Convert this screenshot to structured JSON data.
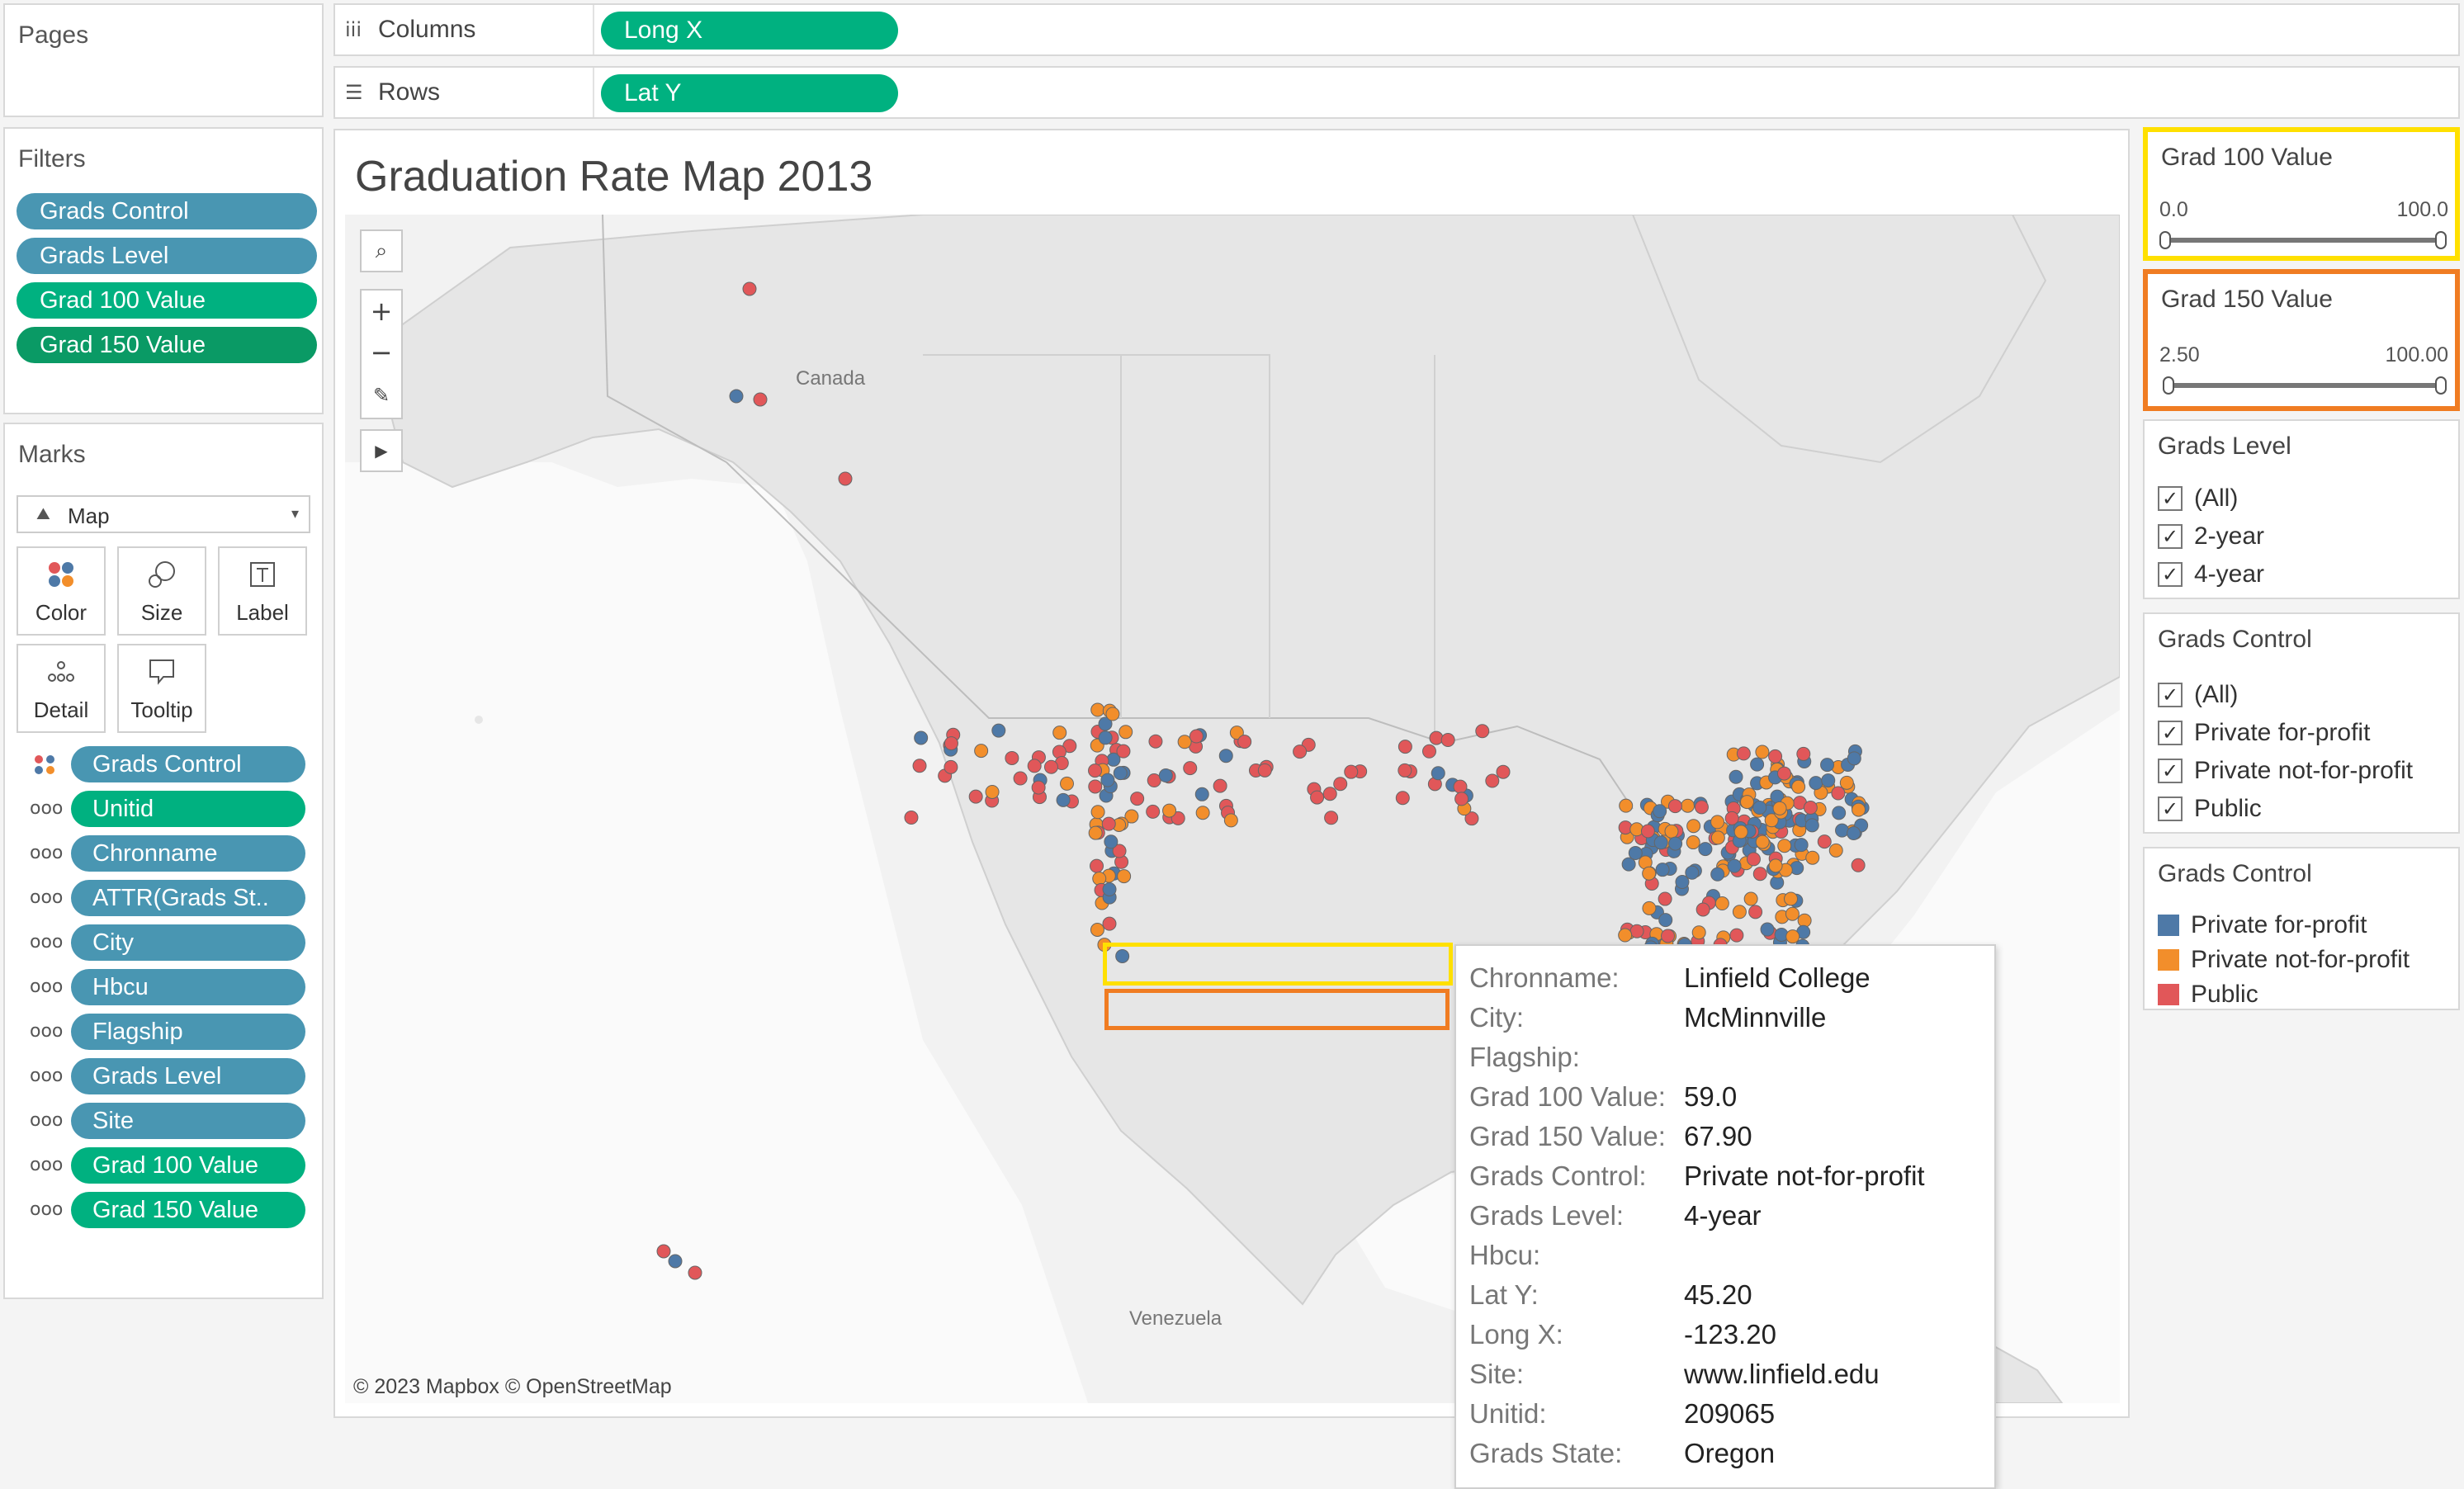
{
  "pages": {
    "title": "Pages"
  },
  "shelves": {
    "columns": {
      "label": "Columns",
      "pill": "Long X",
      "icon": "columns-icon"
    },
    "rows": {
      "label": "Rows",
      "pill": "Lat Y",
      "icon": "rows-icon"
    }
  },
  "filters": {
    "title": "Filters",
    "items": [
      "Grads Control",
      "Grads Level",
      "Grad 100 Value",
      "Grad 150 Value"
    ]
  },
  "marks": {
    "title": "Marks",
    "mark_type": "Map",
    "buttons": [
      "Color",
      "Size",
      "Label",
      "Detail",
      "Tooltip"
    ],
    "fields": [
      "Grads Control",
      "Unitid",
      "Chronname",
      "ATTR(Grads St..",
      "City",
      "Hbcu",
      "Flagship",
      "Grads Level",
      "Site",
      "Grad 100 Value",
      "Grad 150 Value"
    ]
  },
  "viz": {
    "title": "Graduation Rate Map 2013",
    "attribution": "© 2023 Mapbox © OpenStreetMap",
    "map_labels": {
      "canada": "Canada",
      "venezuela": "Venezuela"
    }
  },
  "tooltip": {
    "rows": [
      {
        "key": "Chronname:",
        "value": "Linfield College"
      },
      {
        "key": "City:",
        "value": "McMinnville"
      },
      {
        "key": "Flagship:",
        "value": ""
      },
      {
        "key": "Grad 100 Value:",
        "value": "59.0"
      },
      {
        "key": "Grad 150 Value:",
        "value": "67.90"
      },
      {
        "key": "Grads Control:",
        "value": "Private not-for-profit"
      },
      {
        "key": "Grads Level:",
        "value": "4-year"
      },
      {
        "key": "Hbcu:",
        "value": ""
      },
      {
        "key": "Lat Y:",
        "value": "45.20"
      },
      {
        "key": "Long X:",
        "value": "-123.20"
      },
      {
        "key": "Site:",
        "value": "www.linfield.edu"
      },
      {
        "key": "Unitid:",
        "value": "209065"
      },
      {
        "key": "Grads State:",
        "value": "Oregon"
      }
    ],
    "highlight_colors": {
      "grad100": "#ffe000",
      "grad150": "#f07c22"
    }
  },
  "right": {
    "grad100": {
      "title": "Grad 100 Value",
      "min": "0.0",
      "max": "100.0",
      "range": [
        0.0,
        100.0
      ]
    },
    "grad150": {
      "title": "Grad 150 Value",
      "min": "2.50",
      "max": "100.00",
      "range": [
        2.5,
        100.0
      ]
    },
    "level": {
      "title": "Grads Level",
      "options": [
        "(All)",
        "2-year",
        "4-year"
      ]
    },
    "control": {
      "title": "Grads Control",
      "options": [
        "(All)",
        "Private for-profit",
        "Private not-for-profit",
        "Public"
      ]
    },
    "legend": {
      "title": "Grads Control",
      "items": [
        {
          "label": "Private for-profit",
          "color": "#4e79a7"
        },
        {
          "label": "Private not-for-profit",
          "color": "#f28e2b"
        },
        {
          "label": "Public",
          "color": "#e15759"
        }
      ]
    }
  },
  "colors": {
    "pill_green": "#00b180",
    "pill_blue": "#4996b2",
    "point_blue": "#4e79a7",
    "point_orange": "#f28e2b",
    "point_red": "#e15759"
  }
}
